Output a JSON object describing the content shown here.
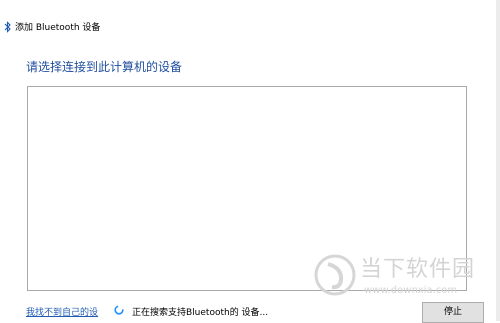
{
  "window": {
    "title": "添加 Bluetooth 设备",
    "icon": "bluetooth-icon"
  },
  "heading": "请选择连接到此计算机的设备",
  "device_list": {
    "items": []
  },
  "footer": {
    "link_label": "我找不到自己的设",
    "status_text": "正在搜索支持Bluetooth的 设备...",
    "spinner_icon": "loading-spinner-icon",
    "stop_label": "停止"
  },
  "watermark": {
    "brand": "当下软件园",
    "url": "www.downxia.com"
  },
  "colors": {
    "heading": "#1f4e9e",
    "link": "#1f5bb3",
    "spinner": "#1e90ff",
    "watermark": "#d4d4d4"
  }
}
